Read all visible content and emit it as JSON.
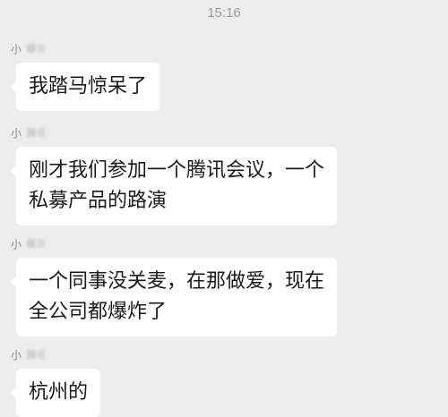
{
  "status": {
    "time": "15:16"
  },
  "messages": [
    {
      "sender_glyph": "小",
      "lines": [
        "我踏马惊呆了"
      ]
    },
    {
      "sender_glyph": "小",
      "lines": [
        "刚才我们参加一个腾讯会议，一个",
        "私募产品的路演"
      ]
    },
    {
      "sender_glyph": "小",
      "lines": [
        "一个同事没关麦，在那做爱，现在",
        "全公司都爆炸了"
      ]
    },
    {
      "sender_glyph": "小",
      "lines": [
        "杭州的"
      ]
    }
  ],
  "colors": {
    "background": "#ededed",
    "bubble": "#ffffff",
    "text": "#1a1a1a",
    "timestamp": "#9b9b9b"
  }
}
